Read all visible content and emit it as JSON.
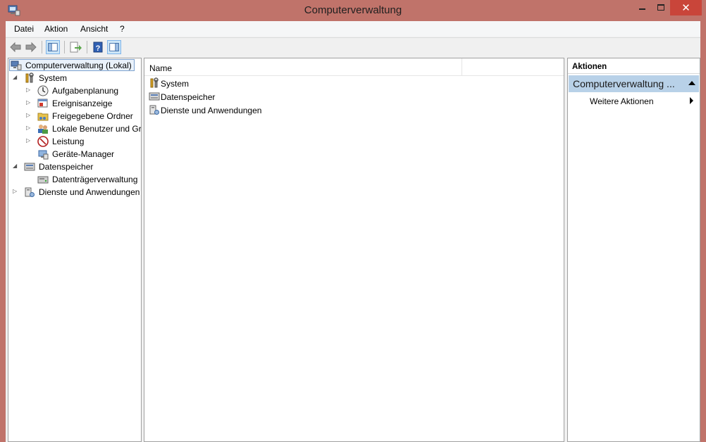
{
  "window": {
    "title": "Computerverwaltung"
  },
  "menu": [
    "Datei",
    "Aktion",
    "Ansicht",
    "?"
  ],
  "toolbar": {
    "buttons": [
      "back-icon",
      "forward-icon",
      "show-tree-icon",
      "export-list-icon",
      "help-icon",
      "show-actions-icon"
    ]
  },
  "tree": {
    "root": "Computerverwaltung (Lokal)",
    "system": "System",
    "aufgabenplanung": "Aufgabenplanung",
    "ereignisanzeige": "Ereignisanzeige",
    "freigegebene_ordner": "Freigegebene Ordner",
    "lokale_benutzer": "Lokale Benutzer und Gruppen",
    "leistung": "Leistung",
    "geraete_manager": "Geräte-Manager",
    "datenspeicher": "Datenspeicher",
    "datentraeger": "Datenträgerverwaltung",
    "dienste": "Dienste und Anwendungen"
  },
  "list": {
    "column_name": "Name",
    "rows": [
      "System",
      "Datenspeicher",
      "Dienste und Anwendungen"
    ]
  },
  "actions": {
    "title": "Aktionen",
    "section": "Computerverwaltung ...",
    "more": "Weitere Aktionen"
  },
  "colors": {
    "titlebar": "#c0736a",
    "close": "#c9453a",
    "action_band": "#b8d1e8",
    "selection": "#7da2ce"
  }
}
